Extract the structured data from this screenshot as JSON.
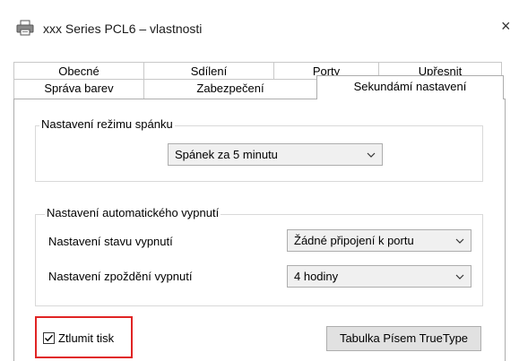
{
  "window": {
    "title": "xxx Series PCL6 – vlastnosti",
    "close_glyph": "×"
  },
  "tabs_back": [
    {
      "label": "Obecné"
    },
    {
      "label": "Sdílení"
    },
    {
      "label": "Porty"
    },
    {
      "label": "Upřesnit"
    }
  ],
  "tabs_front": [
    {
      "label": "Správa barev"
    },
    {
      "label": "Zabezpečení"
    },
    {
      "label": "Sekundámí nastavení"
    }
  ],
  "sleep_group": {
    "legend": "Nastavení režimu spánku",
    "selected": "Spánek za 5 minutu"
  },
  "auto_off_group": {
    "legend": "Nastavení automatického vypnutí",
    "state_label": "Nastavení stavu vypnutí",
    "state_value": "Žádné připojení k portu",
    "delay_label": "Nastavení zpoždění vypnutí",
    "delay_value": "4 hodiny"
  },
  "mute_print": {
    "label": "Ztlumit tisk",
    "checked": true
  },
  "truetype_button": {
    "label": "Tabulka Písem TrueType"
  },
  "colors": {
    "highlight": "#e02424",
    "border": "#adadad"
  }
}
